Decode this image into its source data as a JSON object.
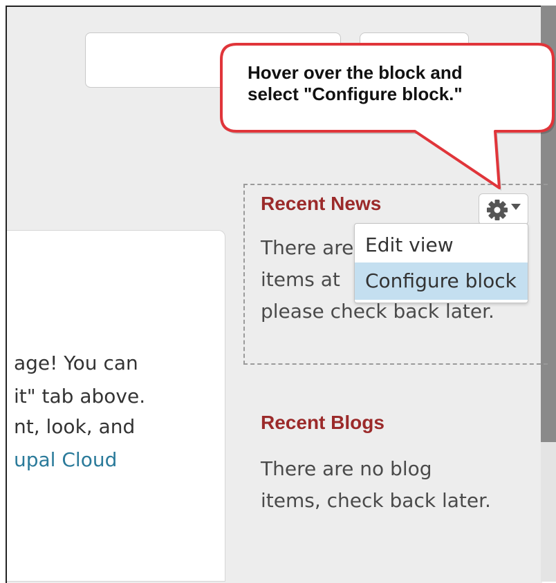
{
  "callout": {
    "text": "Hover over the block and\nselect \"Configure block.\""
  },
  "main": {
    "lines": [
      "age! You can",
      "it\" tab above.",
      "nt, look, and"
    ],
    "link_text": "upal Cloud"
  },
  "recent_news": {
    "title": "Recent News",
    "text_lines": [
      "There are",
      "items at",
      "please check back later."
    ]
  },
  "contextual_menu": {
    "items": [
      {
        "label": "Edit view"
      },
      {
        "label": "Configure block",
        "selected": true
      }
    ]
  },
  "recent_blogs": {
    "title": "Recent Blogs",
    "text_lines": [
      "There are no blog",
      "items, check back later."
    ]
  },
  "colors": {
    "block_title": "#9b2a2a",
    "link": "#2a7a9a",
    "callout_border": "#e0353a",
    "menu_highlight": "#c4dff0"
  },
  "icons": {
    "gear": "gear-icon",
    "dropdown": "caret-down-icon"
  }
}
